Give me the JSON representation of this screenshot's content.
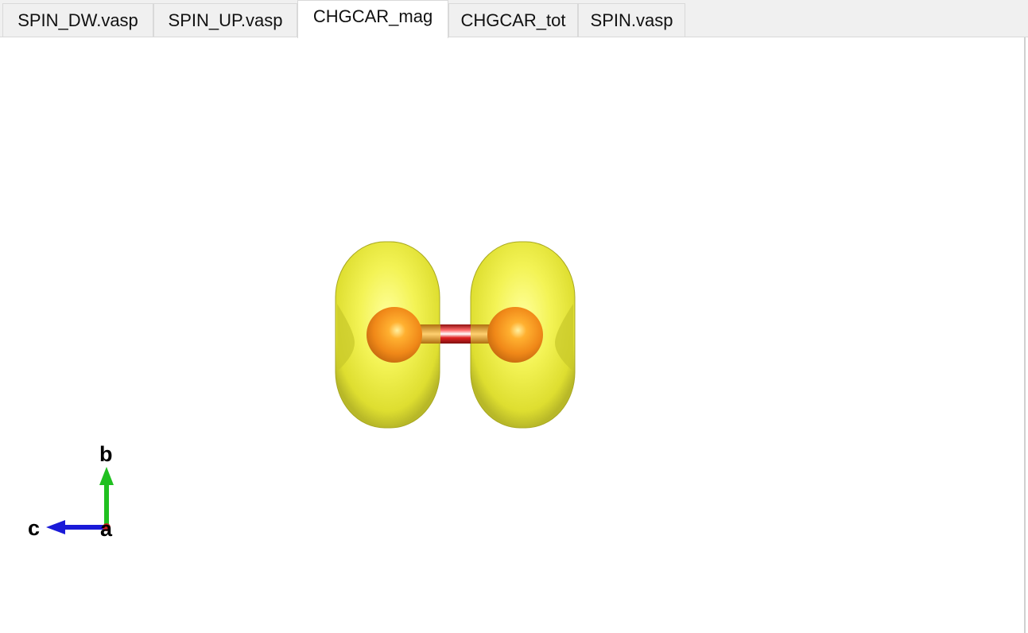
{
  "tabs": [
    {
      "label": "SPIN_DW.vasp",
      "active": false
    },
    {
      "label": "SPIN_UP.vasp",
      "active": false
    },
    {
      "label": "CHGCAR_mag",
      "active": true
    },
    {
      "label": "CHGCAR_tot",
      "active": false
    },
    {
      "label": "SPIN.vasp",
      "active": false
    }
  ],
  "axes": {
    "a": "a",
    "b": "b",
    "c": "c"
  },
  "colors": {
    "isosurface": "#e6e63a",
    "atom": "#f08a18",
    "bond": "#e01818",
    "axis_a": "#cc2020",
    "axis_b": "#20c020",
    "axis_c": "#1a1ad8"
  }
}
